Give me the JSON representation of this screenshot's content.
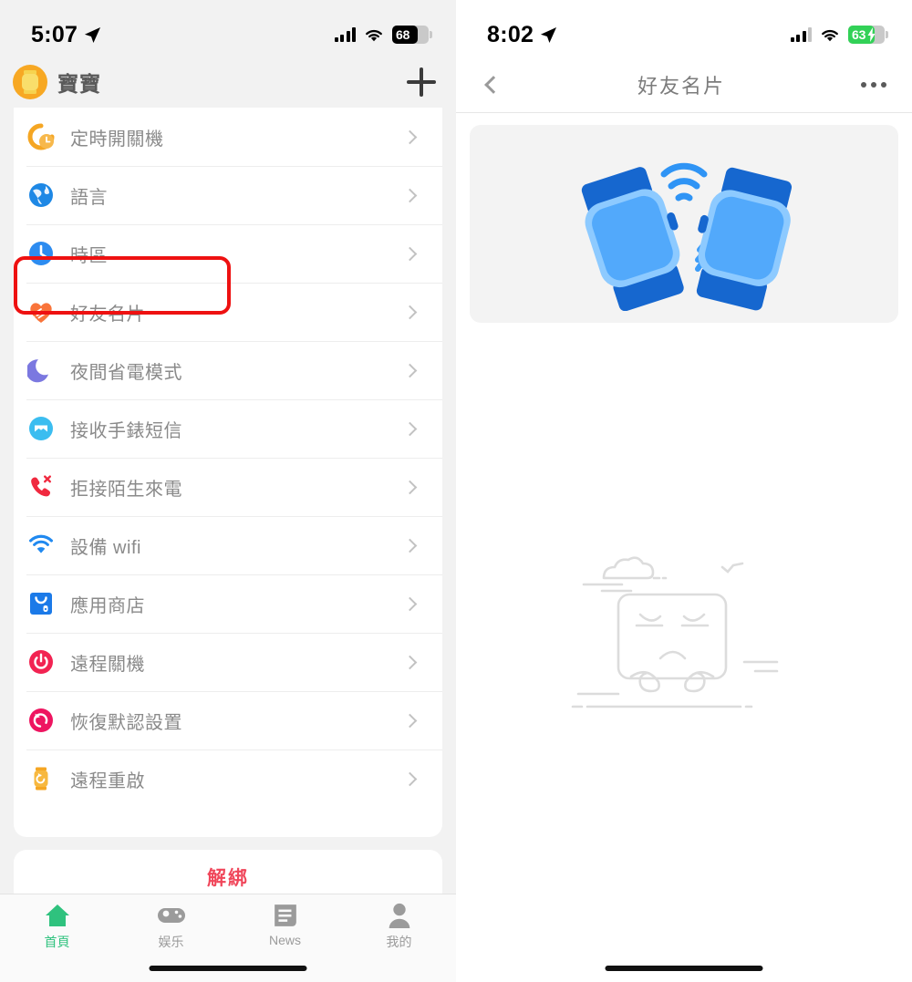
{
  "left": {
    "status_bar": {
      "time": "5:07",
      "location_icon": "location-arrow-icon",
      "signal_icon": "cellular-signal-icon",
      "wifi_icon": "wifi-icon",
      "battery_percent": "68",
      "battery_charging": false
    },
    "header": {
      "avatar_icon": "watch-avatar-icon",
      "title": "寶寶",
      "add_label": "plus-icon"
    },
    "settings_rows": [
      {
        "label": "定時開關機",
        "icon": "schedule-power-icon",
        "color": "#f5a623"
      },
      {
        "label": "語言",
        "icon": "globe-icon",
        "color": "#1e88e5"
      },
      {
        "label": "時區",
        "icon": "clock-icon",
        "color": "#2d8cf0"
      },
      {
        "label": "好友名片",
        "icon": "handshake-heart-icon",
        "color": "#f9743a"
      },
      {
        "label": "夜間省電模式",
        "icon": "moon-icon",
        "color": "#7b78e0"
      },
      {
        "label": "接收手錶短信",
        "icon": "message-icon",
        "color": "#3bbdf0"
      },
      {
        "label": "拒接陌生來電",
        "icon": "call-reject-icon",
        "color": "#f0293f"
      },
      {
        "label": "設備 wifi",
        "icon": "wifi-icon",
        "color": "#2089f0"
      },
      {
        "label": "應用商店",
        "icon": "app-store-icon",
        "color": "#1b7ae8"
      },
      {
        "label": "遠程關機",
        "icon": "power-off-icon",
        "color": "#f22352"
      },
      {
        "label": "恢復默認設置",
        "icon": "restore-icon",
        "color": "#ee1560"
      },
      {
        "label": "遠程重啟",
        "icon": "watch-restart-icon",
        "color": "#f5a623"
      }
    ],
    "highlighted_row_index": 3,
    "highlight_color": "#ee1111",
    "unbind": {
      "label": "解綁",
      "color": "#f0465a"
    },
    "tabs": [
      {
        "label": "首頁",
        "icon": "home-icon",
        "active": true
      },
      {
        "label": "娱乐",
        "icon": "gamepad-icon",
        "active": false
      },
      {
        "label": "News",
        "icon": "news-icon",
        "active": false
      },
      {
        "label": "我的",
        "icon": "person-icon",
        "active": false
      }
    ],
    "active_tab_color": "#2fc27e"
  },
  "right": {
    "status_bar": {
      "time": "8:02",
      "location_icon": "location-arrow-icon",
      "signal_icon": "cellular-signal-icon",
      "wifi_icon": "wifi-icon",
      "battery_percent": "63",
      "battery_charging": true
    },
    "nav": {
      "back_icon": "chevron-left-icon",
      "title": "好友名片",
      "more_icon": "ellipsis-icon"
    },
    "banner": {
      "illustration": "two-watches-pairing-illustration"
    },
    "empty_state": {
      "illustration": "no-data-sad-face-illustration"
    }
  }
}
